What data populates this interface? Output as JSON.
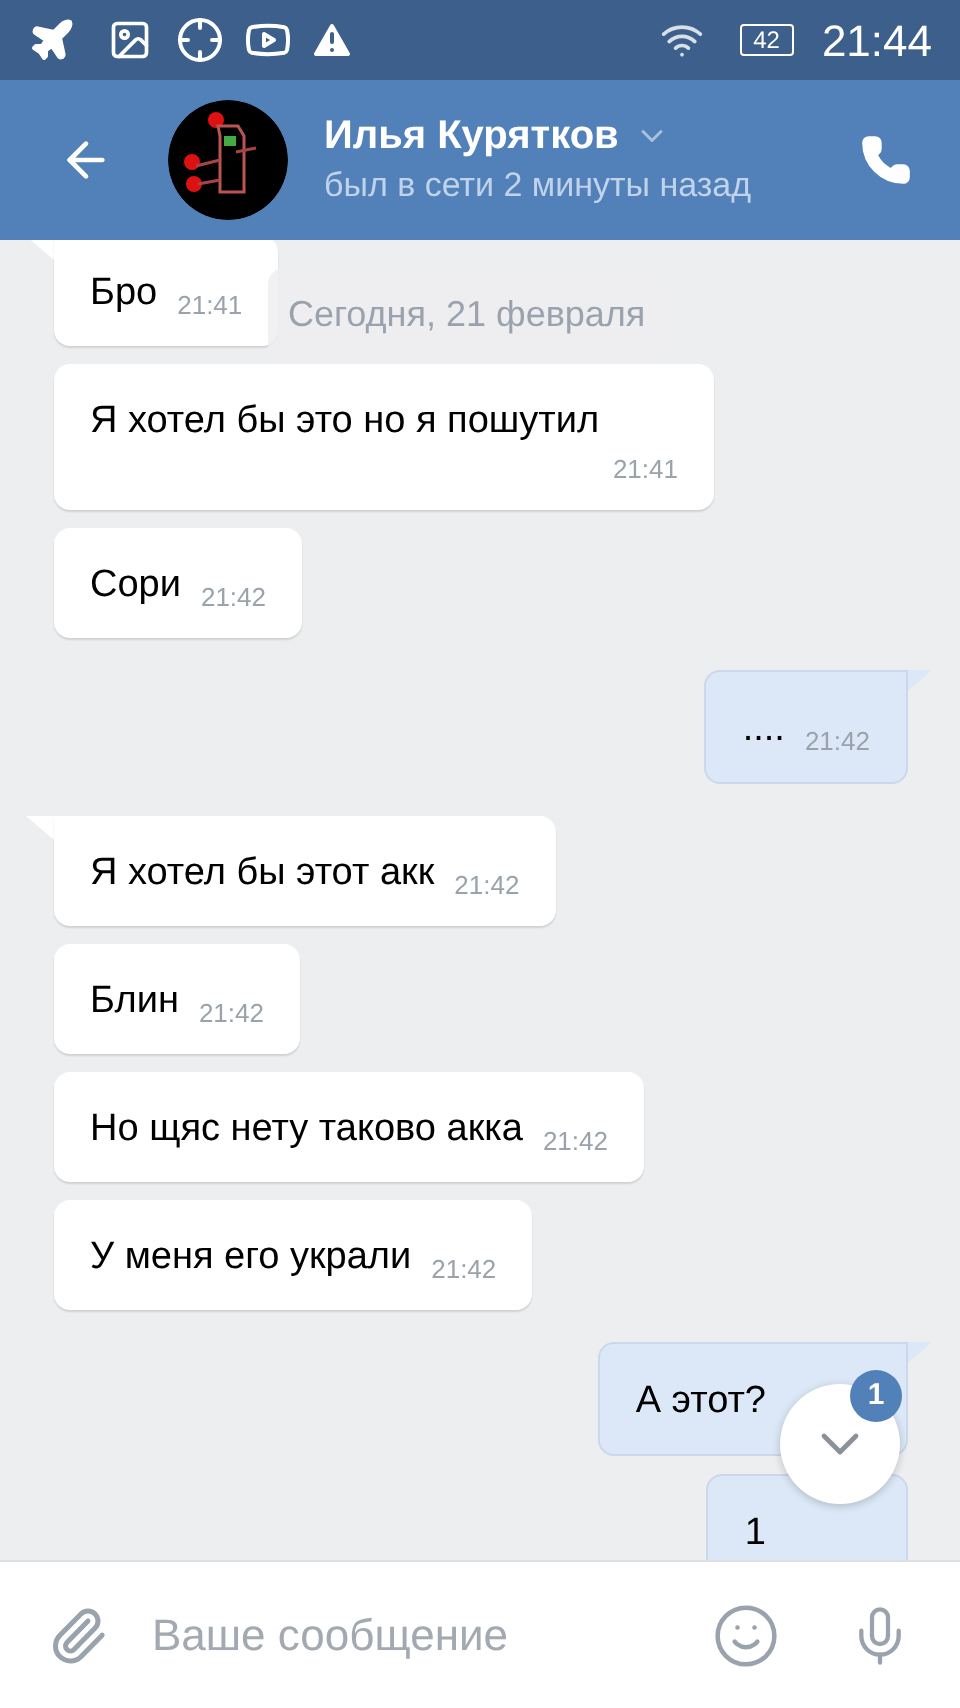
{
  "status_bar": {
    "battery": "42",
    "time": "21:44"
  },
  "header": {
    "name": "Илья Курятков",
    "status": "был в сети 2 минуты назад"
  },
  "date_label": "Сегодня, 21 февраля",
  "messages": [
    {
      "kind": "incoming",
      "tail": true,
      "text": "Бро",
      "time": "21:41"
    },
    {
      "kind": "incoming",
      "tail": false,
      "text": "Я хотел бы это но я пошутил",
      "time": "21:41"
    },
    {
      "kind": "incoming",
      "tail": false,
      "text": "Сори",
      "time": "21:42"
    },
    {
      "kind": "outgoing",
      "tail": true,
      "text": "....",
      "time": "21:42"
    },
    {
      "kind": "incoming",
      "tail": true,
      "text": "Я хотел бы этот акк",
      "time": "21:42"
    },
    {
      "kind": "incoming",
      "tail": false,
      "text": "Блин",
      "time": "21:42"
    },
    {
      "kind": "incoming",
      "tail": false,
      "text": "Но щяс нету таково акка",
      "time": "21:42"
    },
    {
      "kind": "incoming",
      "tail": false,
      "text": "У меня его украли",
      "time": "21:42"
    },
    {
      "kind": "outgoing",
      "tail": true,
      "text": "А этот?"
    },
    {
      "kind": "outgoing",
      "tail": false,
      "text": "1"
    }
  ],
  "scroll_button": {
    "badge": "1"
  },
  "composer": {
    "placeholder": "Ваше сообщение"
  }
}
